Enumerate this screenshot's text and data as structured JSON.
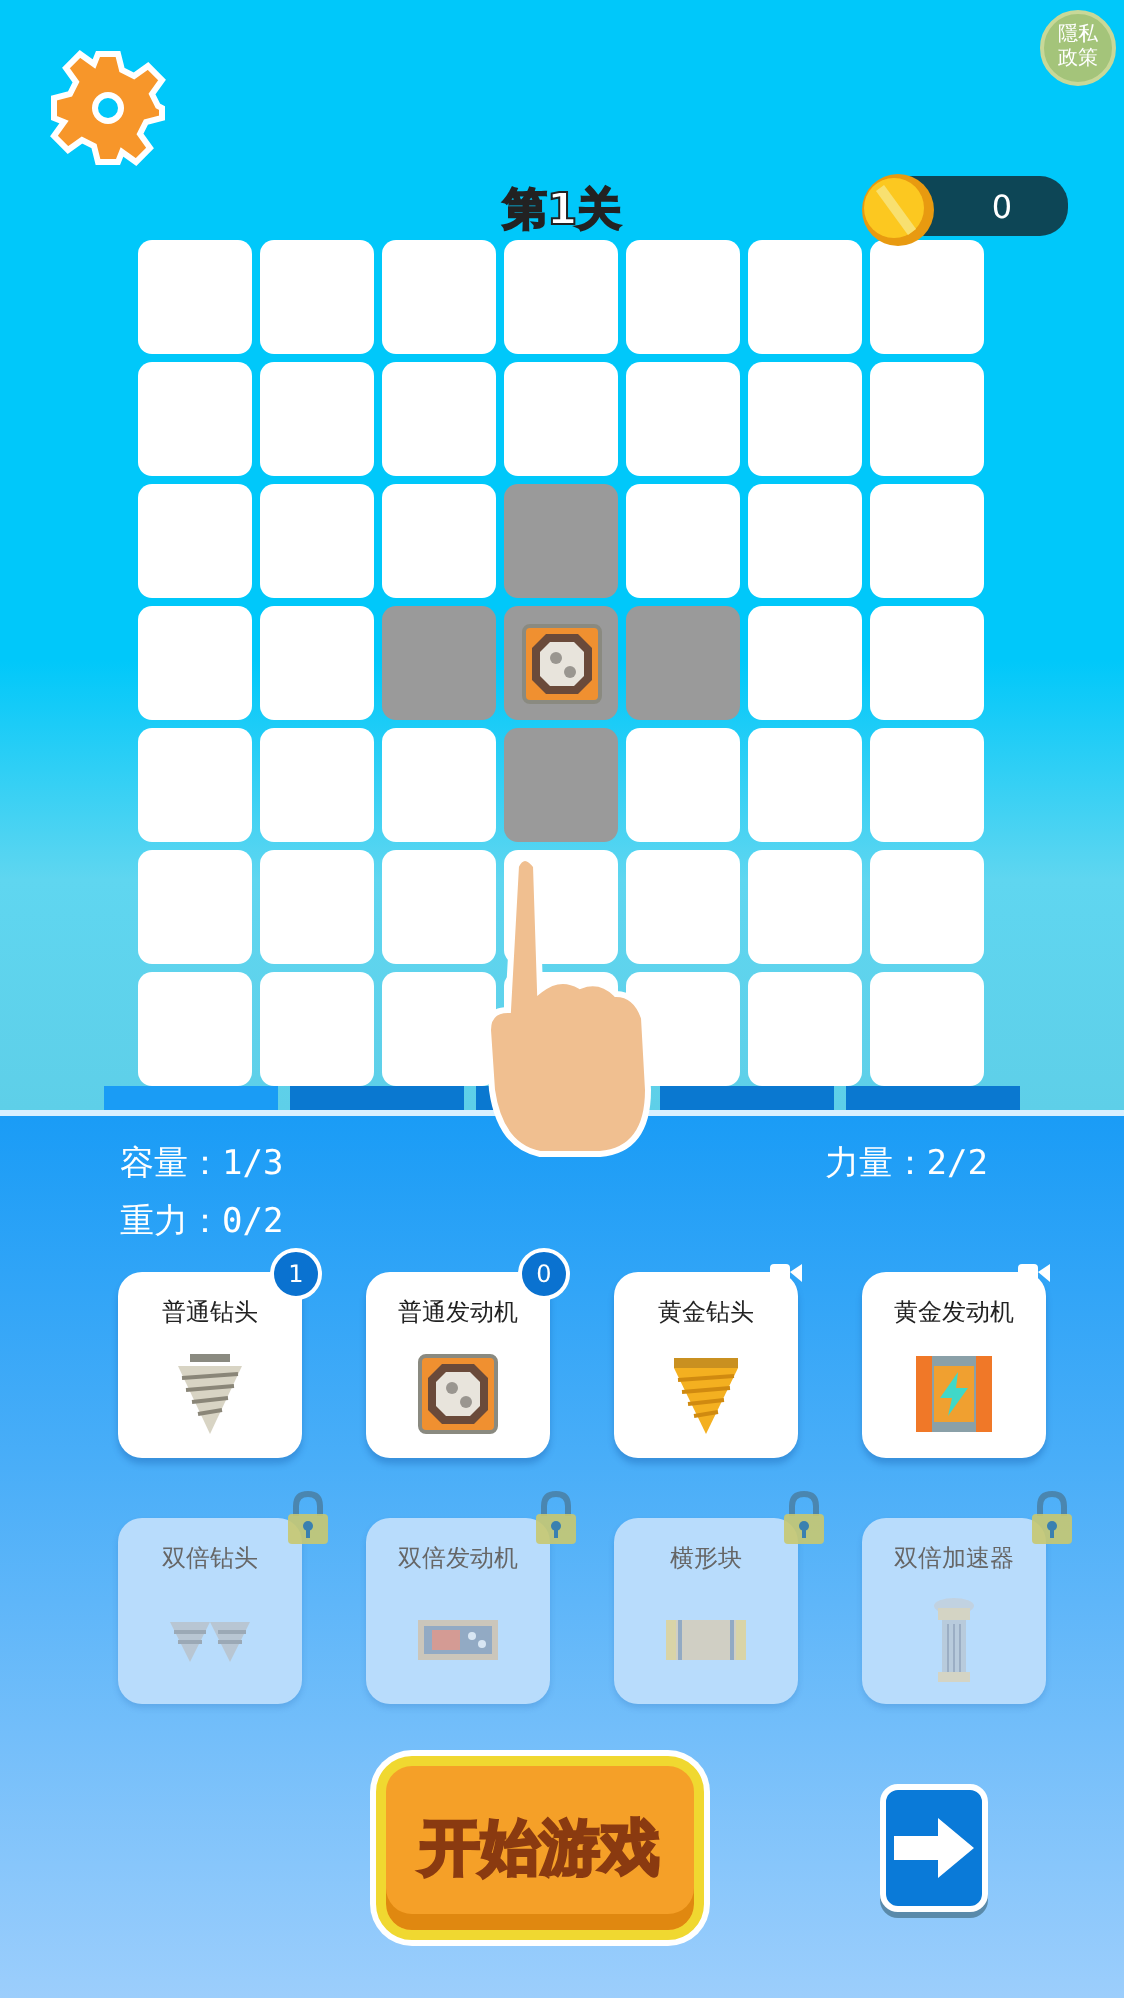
{
  "privacy_badge": {
    "label": "隱私政策"
  },
  "level_title": "第1关",
  "coins": "0",
  "grid": {
    "rows": [
      [
        {
          "kind": "empty"
        },
        {
          "kind": "empty"
        },
        {
          "kind": "empty"
        },
        {
          "kind": "empty"
        },
        {
          "kind": "empty"
        },
        {
          "kind": "empty"
        },
        {
          "kind": "empty"
        }
      ],
      [
        {
          "kind": "empty"
        },
        {
          "kind": "empty"
        },
        {
          "kind": "empty"
        },
        {
          "kind": "empty"
        },
        {
          "kind": "empty"
        },
        {
          "kind": "empty"
        },
        {
          "kind": "empty"
        }
      ],
      [
        {
          "kind": "empty"
        },
        {
          "kind": "empty"
        },
        {
          "kind": "empty"
        },
        {
          "kind": "grey"
        },
        {
          "kind": "empty"
        },
        {
          "kind": "empty"
        },
        {
          "kind": "empty"
        }
      ],
      [
        {
          "kind": "empty"
        },
        {
          "kind": "empty"
        },
        {
          "kind": "grey"
        },
        {
          "kind": "engine"
        },
        {
          "kind": "grey"
        },
        {
          "kind": "empty"
        },
        {
          "kind": "empty"
        }
      ],
      [
        {
          "kind": "empty"
        },
        {
          "kind": "empty"
        },
        {
          "kind": "empty"
        },
        {
          "kind": "grey"
        },
        {
          "kind": "empty"
        },
        {
          "kind": "empty"
        },
        {
          "kind": "empty"
        }
      ],
      [
        {
          "kind": "empty"
        },
        {
          "kind": "empty"
        },
        {
          "kind": "empty"
        },
        {
          "kind": "empty"
        },
        {
          "kind": "empty"
        },
        {
          "kind": "empty"
        },
        {
          "kind": "empty"
        }
      ],
      [
        {
          "kind": "empty"
        },
        {
          "kind": "empty"
        },
        {
          "kind": "empty"
        },
        {
          "kind": "empty"
        },
        {
          "kind": "empty"
        },
        {
          "kind": "empty"
        },
        {
          "kind": "empty"
        }
      ]
    ]
  },
  "tabs": [
    {
      "selected": true
    },
    {
      "selected": false
    },
    {
      "selected": false
    },
    {
      "selected": false
    },
    {
      "selected": false
    }
  ],
  "stats": {
    "capacity": "容量：1/3",
    "power": "力量：2/2",
    "gravity": "重力：0/2"
  },
  "parts": [
    {
      "label": "普通钻头",
      "kind": "drill",
      "count": "1",
      "video": false,
      "locked": false
    },
    {
      "label": "普通发动机",
      "kind": "engine",
      "count": "0",
      "video": false,
      "locked": false
    },
    {
      "label": "黄金钻头",
      "kind": "gold-drill",
      "video": true,
      "locked": false
    },
    {
      "label": "黄金发动机",
      "kind": "gold-engine",
      "video": true,
      "locked": false
    },
    {
      "label": "双倍钻头",
      "kind": "double-drill",
      "video": false,
      "locked": true
    },
    {
      "label": "双倍发动机",
      "kind": "double-engine",
      "video": false,
      "locked": true
    },
    {
      "label": "横形块",
      "kind": "horizontal-block",
      "video": false,
      "locked": true
    },
    {
      "label": "双倍加速器",
      "kind": "accelerator",
      "video": false,
      "locked": true
    }
  ],
  "start_button": "开始游戏"
}
